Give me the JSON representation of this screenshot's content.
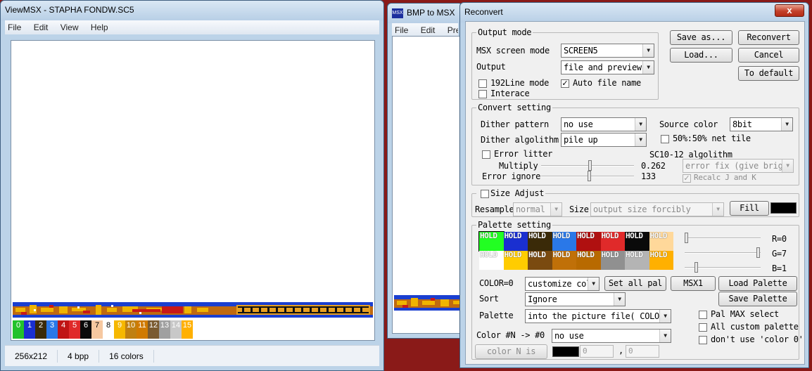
{
  "viewmsx": {
    "title": "ViewMSX - STAPHA FONDW.SC5",
    "menu": [
      "File",
      "Edit",
      "View",
      "Help"
    ],
    "palette_labels": [
      "0",
      "1",
      "2",
      "3",
      "4",
      "5",
      "6",
      "7",
      "8",
      "9",
      "10",
      "11",
      "12",
      "13",
      "14",
      "15"
    ],
    "palette_colors": [
      "#22c22a",
      "#1a2fd0",
      "#3a2a08",
      "#2a78e8",
      "#c01414",
      "#e02a2a",
      "#0a0a0a",
      "#f6c8a0",
      "#ffffff",
      "#f6b800",
      "#c08010",
      "#d07a00",
      "#7a5a30",
      "#a0a0a0",
      "#c8c8c8",
      "#ffb000"
    ],
    "status": {
      "size": "256x212",
      "bpp": "4 bpp",
      "colors": "16 colors"
    }
  },
  "bmp2msx": {
    "icon_text": "MSX",
    "title": "BMP to MSX",
    "menu": [
      "File",
      "Edit",
      "Prev"
    ]
  },
  "reconvert": {
    "title": "Reconvert",
    "close_glyph": "x",
    "buttons": {
      "save_as": "Save as...",
      "reconvert": "Reconvert",
      "load": "Load...",
      "cancel": "Cancel",
      "to_default": "To default"
    },
    "output_mode": {
      "title": "Output mode",
      "screen_mode_label": "MSX screen mode",
      "screen_mode_value": "SCREEN5",
      "output_label": "Output",
      "output_value": "file and preview",
      "line192_label": "192Line mode",
      "line192_checked": false,
      "auto_file_name_label": "Auto file name",
      "auto_file_name_checked": true,
      "interace_label": "Interace",
      "interace_checked": false
    },
    "convert_setting": {
      "title": "Convert setting",
      "dither_pattern_label": "Dither pattern",
      "dither_pattern_value": "no use",
      "source_color_label": "Source color",
      "source_color_value": "8bit",
      "dither_algorithm_label": "Dither algolithm",
      "dither_algorithm_value": "pile up",
      "net_tile_label": "50%:50% net tile",
      "net_tile_checked": false,
      "error_litter_label": "Error litter",
      "error_litter_checked": false,
      "sc_algorithm_label": "SC10-12 algolithm",
      "multiply_label": "Multiply",
      "multiply_value": "0.262",
      "multiply_level": 0.53,
      "error_fix_value": "error fix (give brightn",
      "error_ignore_label": "Error ignore",
      "error_ignore_value": "133",
      "error_ignore_level": 0.52,
      "recalc_label": "Recalc J and K",
      "recalc_checked": true
    },
    "size_adjust": {
      "title": "Size Adjust",
      "checked": false,
      "resample_label": "Resample",
      "resample_value": "normal",
      "size_label": "Size",
      "size_value": "output size forcibly",
      "fill_label": "Fill",
      "fill_color": "#000000"
    },
    "palette_setting": {
      "title": "Palette setting",
      "hold_label": "HOLD",
      "colors": [
        "#22ff22",
        "#1a2fd0",
        "#3a2a08",
        "#2a78e8",
        "#b01010",
        "#e02a2a",
        "#0a0a0a",
        "#ffd89a",
        "#ffffff",
        "#ffcc00",
        "#7a4a10",
        "#c07008",
        "#b86a00",
        "#909090",
        "#b4b4b4",
        "#ffb000"
      ],
      "r_label": "R=0",
      "r_level": 0,
      "g_label": "G=7",
      "g_level": 1,
      "b_label": "B=1",
      "b_level": 0.14,
      "color_label": "COLOR=0",
      "customize_value": "customize color",
      "set_all_pal": "Set all pal",
      "msx1": "MSX1",
      "load_palette": "Load Palette",
      "save_palette": "Save Palette",
      "sort_label": "Sort",
      "sort_value": "Ignore",
      "palette_label": "Palette",
      "palette_value": "into the picture file( COLOR=RE",
      "pal_max_label": "Pal MAX select",
      "pal_max_checked": false,
      "all_custom_label": "All custom palette",
      "all_custom_checked": false,
      "dont_use_label": "don't use 'color 0'",
      "dont_use_checked": false,
      "color_n_label": "Color #N -> #0",
      "color_n_value": "no use",
      "color_n_is": "color N is",
      "n_swatch_color": "#000000",
      "n_val1": "0",
      "comma": ",",
      "n_val2": "0"
    }
  }
}
